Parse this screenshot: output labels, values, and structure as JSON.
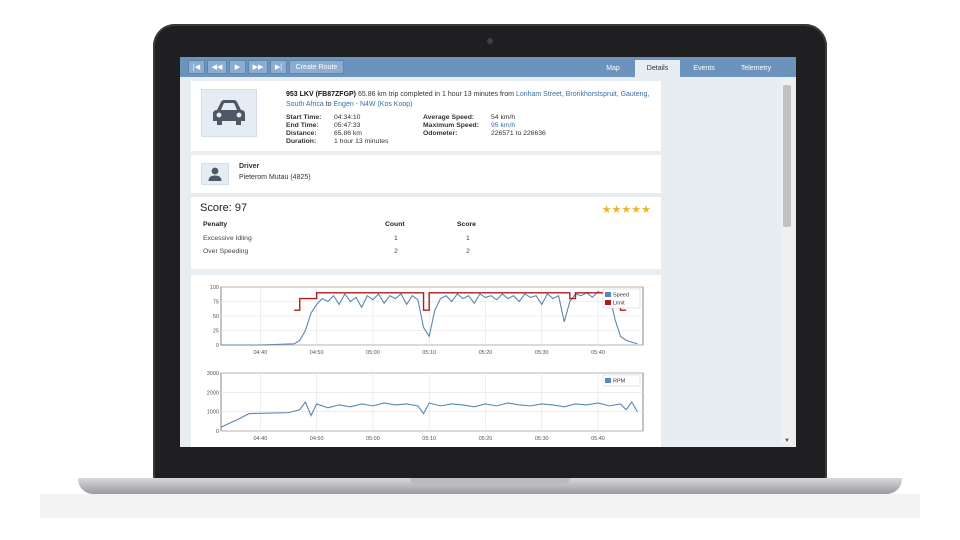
{
  "toolbar": {
    "buttons": [
      "|◀",
      "◀◀",
      "▶",
      "▶▶",
      "▶|"
    ],
    "create_route": "Create Route",
    "tabs": [
      {
        "label": "Map",
        "active": false
      },
      {
        "label": "Details",
        "active": true
      },
      {
        "label": "Events",
        "active": false
      },
      {
        "label": "Telemetry",
        "active": false
      }
    ]
  },
  "trip": {
    "vehicle": "953 LKV (FB87ZFGP)",
    "summary": " 65.86 km trip completed in 1 hour 13 minutes from ",
    "from_place": "Lonham Street, Bronkhorstspruit, Gauteng, South Africa",
    "to_word": " to ",
    "to_place": "Engen - N4W (Kos Koop)",
    "start_time_label": "Start Time:",
    "start_time": "04:34:10",
    "end_time_label": "End Time:",
    "end_time": "05:47:33",
    "distance_label": "Distance:",
    "distance": "65.86 km",
    "duration_label": "Duration:",
    "duration": "1 hour 13 minutes",
    "avg_speed_label": "Average Speed:",
    "avg_speed": "54 km/h",
    "max_speed_label": "Maximum Speed:",
    "max_speed": "95 km/h",
    "odometer_label": "Odometer:",
    "odometer": "226571 to 226636"
  },
  "driver": {
    "heading": "Driver",
    "name": "Pieterom Mutau (4825)"
  },
  "score": {
    "title": "Score: 97",
    "stars": "★★★★★",
    "stars_count": 5,
    "headers": [
      "Penalty",
      "Count",
      "Score"
    ],
    "rows": [
      [
        "Excessive Idling",
        "1",
        "1"
      ],
      [
        "Over Speeding",
        "2",
        "2"
      ]
    ]
  },
  "colors": {
    "speed": "#5b87b3",
    "limit": "#b01c1c",
    "rpm": "#5b87b3",
    "toolbar": "#6c93bb"
  },
  "chart_data": [
    {
      "type": "line",
      "x_ticks": [
        "04:40",
        "04:50",
        "05:00",
        "05:10",
        "05:20",
        "05:30",
        "05:40"
      ],
      "y_ticks": [
        "100",
        "75",
        "50",
        "25",
        "0"
      ],
      "ylim": [
        0,
        100
      ],
      "xlim": [
        "04:33",
        "05:48"
      ],
      "legend": "top-right",
      "grid": true,
      "series": [
        {
          "name": "Speed",
          "x": [
            "04:33",
            "04:40",
            "04:46",
            "04:47",
            "04:48",
            "04:49",
            "04:50",
            "04:51",
            "04:52",
            "04:53",
            "04:54",
            "04:55",
            "04:56",
            "04:57",
            "04:58",
            "04:59",
            "05:00",
            "05:01",
            "05:02",
            "05:03",
            "05:04",
            "05:05",
            "05:06",
            "05:07",
            "05:08",
            "05:09",
            "05:10",
            "05:11",
            "05:12",
            "05:13",
            "05:14",
            "05:15",
            "05:16",
            "05:17",
            "05:18",
            "05:19",
            "05:20",
            "05:21",
            "05:22",
            "05:23",
            "05:24",
            "05:25",
            "05:26",
            "05:27",
            "05:28",
            "05:29",
            "05:30",
            "05:31",
            "05:32",
            "05:33",
            "05:34",
            "05:35",
            "05:36",
            "05:37",
            "05:38",
            "05:39",
            "05:40",
            "05:41",
            "05:42",
            "05:43",
            "05:44",
            "05:45",
            "05:46",
            "05:47"
          ],
          "values": [
            0,
            0,
            2,
            8,
            25,
            55,
            70,
            80,
            75,
            85,
            70,
            88,
            75,
            82,
            65,
            85,
            78,
            88,
            72,
            85,
            80,
            88,
            70,
            85,
            78,
            30,
            15,
            60,
            80,
            85,
            75,
            88,
            80,
            85,
            72,
            88,
            82,
            85,
            78,
            88,
            80,
            85,
            75,
            88,
            82,
            85,
            70,
            88,
            80,
            85,
            40,
            75,
            88,
            85,
            90,
            82,
            92,
            88,
            90,
            45,
            15,
            8,
            5,
            2
          ]
        },
        {
          "name": "Limit",
          "x": [
            "04:46",
            "04:47",
            "04:48",
            "04:49",
            "04:50",
            "05:08",
            "05:09",
            "05:10",
            "05:34",
            "05:35",
            "05:36",
            "05:43",
            "05:44",
            "05:45"
          ],
          "values": [
            60,
            80,
            80,
            80,
            90,
            90,
            60,
            90,
            90,
            80,
            90,
            90,
            60,
            60
          ]
        }
      ]
    },
    {
      "type": "line",
      "x_ticks": [
        "04:40",
        "04:50",
        "05:00",
        "05:10",
        "05:20",
        "05:30",
        "05:40"
      ],
      "y_ticks": [
        "3000",
        "2000",
        "1000",
        "0"
      ],
      "ylim": [
        0,
        3000
      ],
      "xlim": [
        "04:33",
        "05:48"
      ],
      "legend": "top-right",
      "grid": true,
      "series": [
        {
          "name": "RPM",
          "x": [
            "04:33",
            "04:36",
            "04:38",
            "04:45",
            "04:47",
            "04:48",
            "04:49",
            "04:50",
            "04:52",
            "04:54",
            "04:56",
            "04:58",
            "05:00",
            "05:02",
            "05:04",
            "05:06",
            "05:08",
            "05:09",
            "05:10",
            "05:12",
            "05:14",
            "05:16",
            "05:18",
            "05:20",
            "05:22",
            "05:24",
            "05:26",
            "05:28",
            "05:30",
            "05:32",
            "05:34",
            "05:36",
            "05:38",
            "05:40",
            "05:42",
            "05:44",
            "05:45",
            "05:46",
            "05:47"
          ],
          "values": [
            200,
            600,
            900,
            950,
            1100,
            1500,
            800,
            1400,
            1200,
            1350,
            1250,
            1400,
            1300,
            1450,
            1350,
            1400,
            1300,
            900,
            1450,
            1300,
            1400,
            1350,
            1250,
            1400,
            1300,
            1450,
            1350,
            1300,
            1400,
            1350,
            1250,
            1400,
            1350,
            1450,
            1300,
            1400,
            1100,
            1500,
            1000
          ]
        }
      ]
    }
  ]
}
